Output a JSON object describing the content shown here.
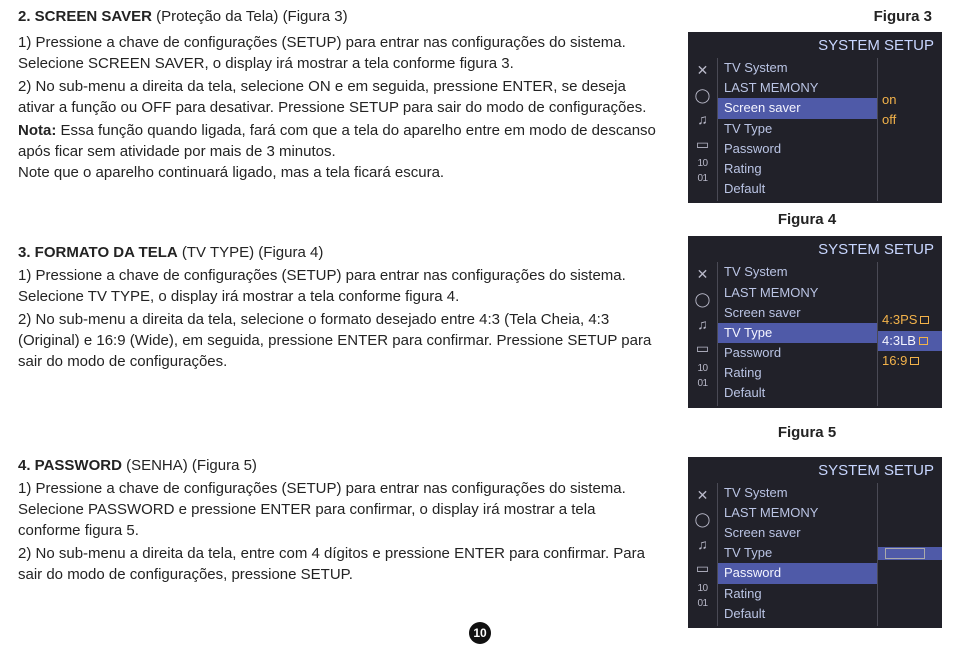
{
  "sections": {
    "s2": {
      "title": "2. SCREEN SAVER",
      "subtitle": " (Proteção da Tela) (Figura 3)",
      "p1": "1) Pressione a chave de configurações (SETUP) para entrar nas configurações do sistema. Selecione SCREEN SAVER, o display irá mostrar a tela conforme figura 3.",
      "p2": "2) No sub-menu a direita da tela, selecione ON e em seguida, pressione ENTER, se deseja ativar a função ou OFF para desativar. Pressione SETUP para sair do modo de configurações.",
      "note_label": "Nota:",
      "note_body": " Essa função quando ligada, fará com que a tela do aparelho entre em modo de descanso após ficar sem atividade por mais de 3 minutos.",
      "note_tail": "Note que o aparelho continuará ligado, mas a tela ficará escura."
    },
    "s3": {
      "title": "3. FORMATO DA TELA",
      "subtitle": " (TV TYPE) (Figura 4)",
      "p1": "1) Pressione a chave de configurações (SETUP) para entrar nas configurações do sistema. Selecione TV TYPE, o display irá mostrar a tela conforme figura 4.",
      "p2": "2) No sub-menu a direita da tela, selecione o formato desejado entre 4:3 (Tela Cheia, 4:3 (Original) e 16:9 (Wide), em seguida, pressione ENTER para confirmar. Pressione SETUP para sair do modo de configurações."
    },
    "s4": {
      "title": "4. PASSWORD",
      "subtitle": " (SENHA) (Figura 5)",
      "p1": "1) Pressione a chave de configurações (SETUP) para entrar nas configurações do sistema. Selecione PASSWORD e pressione ENTER para confirmar, o display irá mostrar a tela conforme figura 5.",
      "p2": "2) No sub-menu a direita da tela, entre com 4 dígitos e pressione ENTER para confirmar. Para sair do modo de configurações, pressione SETUP."
    }
  },
  "figlabels": {
    "f3": "Figura 3",
    "f4": "Figura 4",
    "f5": "Figura 5"
  },
  "osd": {
    "header": "SYSTEM  SETUP",
    "icons": {
      "tools": "✕",
      "speech": "◯",
      "music": "♫",
      "rect": "▭",
      "ten": "10",
      "zeroone": "01"
    },
    "menu": {
      "tvsystem": "TV System",
      "lastmem": "LAST MEMONY",
      "screensaver": "Screen saver",
      "tvtype": "TV Type",
      "password": "Password",
      "rating": "Rating",
      "default": "Default"
    },
    "fig3_vals": {
      "on": "on",
      "off": "off"
    },
    "fig4_vals": {
      "v1": "4:3PS",
      "v2": "4:3LB",
      "v3": "16:9"
    }
  },
  "page": "10"
}
